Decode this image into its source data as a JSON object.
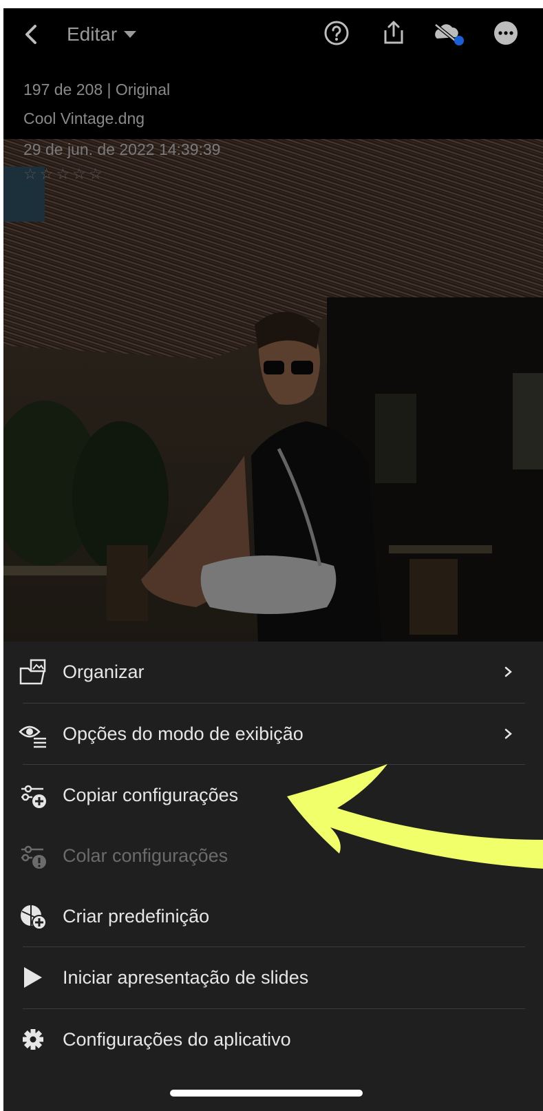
{
  "header": {
    "edit_label": "Editar",
    "icons": [
      "back-chevron-icon",
      "help-icon",
      "share-icon",
      "cloud-sync-off-icon",
      "more-icon"
    ]
  },
  "photo_info": {
    "position": "197 de 208 | Original",
    "filename": "Cool Vintage.dng",
    "datetime": "29 de jun. de 2022 14:39:39",
    "rating_stars": "☆☆☆☆☆"
  },
  "menu": {
    "items": [
      {
        "label": "Organizar",
        "icon": "organize-icon",
        "has_submenu": true,
        "enabled": true
      },
      {
        "label": "Opções do modo de exibição",
        "icon": "view-options-icon",
        "has_submenu": true,
        "enabled": true
      },
      {
        "label": "Copiar configurações",
        "icon": "copy-settings-icon",
        "has_submenu": false,
        "enabled": true
      },
      {
        "label": "Colar configurações",
        "icon": "paste-settings-icon",
        "has_submenu": false,
        "enabled": false
      },
      {
        "label": "Criar predefinição",
        "icon": "create-preset-icon",
        "has_submenu": false,
        "enabled": true
      },
      {
        "label": "Iniciar apresentação de slides",
        "icon": "play-icon",
        "has_submenu": false,
        "enabled": true
      },
      {
        "label": "Configurações do aplicativo",
        "icon": "gear-icon",
        "has_submenu": false,
        "enabled": true
      }
    ]
  },
  "colors": {
    "menu_bg": "#1f1f1f",
    "highlight_arrow": "#f0ff6a",
    "sync_dot": "#1a5fd6"
  }
}
